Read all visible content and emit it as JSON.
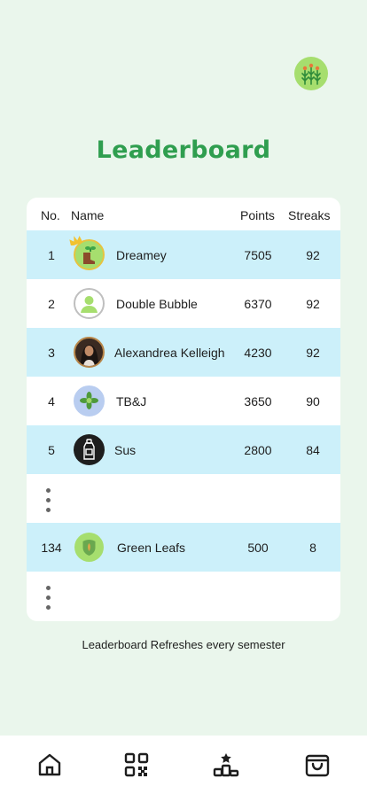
{
  "page": {
    "title": "Leaderboard",
    "footer_note": "Leaderboard Refreshes every semester"
  },
  "table": {
    "headers": {
      "no": "No.",
      "name": "Name",
      "points": "Points",
      "streaks": "Streaks"
    },
    "rows": [
      {
        "no": "1",
        "name": "Dreamey",
        "points": "7505",
        "streaks": "92",
        "avatar": "boot-plant-icon",
        "crown": true
      },
      {
        "no": "2",
        "name": "Double Bubble",
        "points": "6370",
        "streaks": "92",
        "avatar": "default-user-icon"
      },
      {
        "no": "3",
        "name": "Alexandrea Kelleigh",
        "points": "4230",
        "streaks": "92",
        "avatar": "photo-avatar"
      },
      {
        "no": "4",
        "name": "TB&J",
        "points": "3650",
        "streaks": "90",
        "avatar": "succulent-icon"
      },
      {
        "no": "5",
        "name": "Sus",
        "points": "2800",
        "streaks": "84",
        "avatar": "bottle-icon"
      },
      {
        "no": "134",
        "name": "Green Leafs",
        "points": "500",
        "streaks": "8",
        "avatar": "leaf-shield-icon"
      }
    ]
  },
  "nav": [
    "home-icon",
    "qr-code-icon",
    "leaderboard-icon",
    "shopping-bag-icon"
  ],
  "colors": {
    "background": "#eaf6ec",
    "title": "#2f9e4f",
    "highlight_row": "#ccf0fa",
    "card": "#ffffff"
  }
}
